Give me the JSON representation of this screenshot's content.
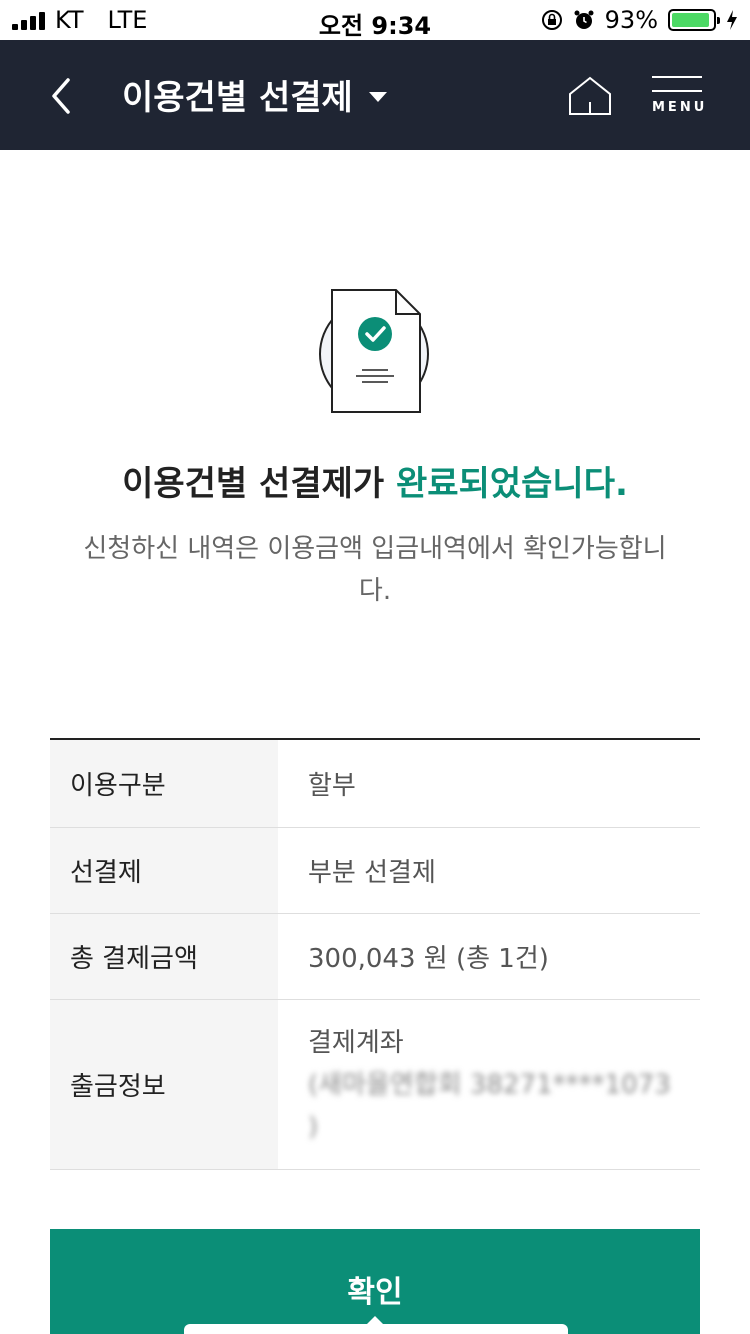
{
  "status_bar": {
    "carrier": "KT",
    "network": "LTE",
    "time": "오전 9:34",
    "battery": "93%",
    "battery_level": 0.93
  },
  "header": {
    "title": "이용건별 선결제",
    "menu_label": "MENU"
  },
  "result": {
    "headline_prefix": "이용건별 선결제가 ",
    "headline_accent": "완료되었습니다.",
    "description": "신청하신 내역은 이용금액 입금내역에서 확인가능합니다.",
    "accent_color": "#0b8e77"
  },
  "details": [
    {
      "key": "이용구분",
      "value": "할부"
    },
    {
      "key": "선결제",
      "value": "부분 선결제"
    },
    {
      "key": "총 결제금액",
      "value": "300,043 원 (총 1건)"
    },
    {
      "key": "출금정보",
      "value_line1": "결제계좌",
      "value_line2": "(새마을연합회 38271****1073",
      "value_line3": ")"
    }
  ],
  "confirm_button": {
    "label": "확인"
  }
}
